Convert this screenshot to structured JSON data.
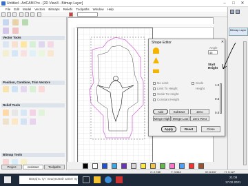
{
  "window": {
    "title": "Untitled - ArtCAM Pro - [2D View3 - Bitmap Layer]"
  },
  "menu": [
    "File",
    "Edit",
    "Model",
    "Vectors",
    "Bitmaps",
    "Reliefs",
    "Toolpaths",
    "Window",
    "Help"
  ],
  "left_panel": {
    "sections": {
      "vector_tools": "Vector Tools",
      "position": "Position, Combine, Trim Vectors",
      "relief_tools": "Relief Tools",
      "bitmap_tools": "Bitmap Tools"
    },
    "tabs": [
      "Project",
      "Assistant",
      "Toolpaths"
    ]
  },
  "right_panel": {
    "bitmap_label": "Bitmap Layer"
  },
  "dialog": {
    "title": "Shape Editor",
    "angle_label": "Angle",
    "angle_value": "45",
    "start_height_label": "Start Height",
    "no_limit": "No Limit",
    "limit_to_height": "Limit To Height",
    "scale_to_height": "Scale To Height",
    "constant_height": "Constant Height",
    "scale_label": "Scale",
    "height_label": "Height",
    "scale_right": "Scale",
    "top_value": "1.0",
    "mid_value": "0.5",
    "bottom_value": "0.0",
    "buttons": {
      "add": "Add",
      "subtract": "Subtract",
      "zero": "Zero",
      "merge_high": "Merge High",
      "merge_low": "Merge Low",
      "zero_rest": "Zero Rest",
      "apply": "Apply",
      "reset": "Reset",
      "close": "Close"
    }
  },
  "palette_colors": [
    "#000000",
    "#ffffff",
    "#1f4fd8",
    "#37a8e6",
    "#6c2fbf",
    "#d7d7d7",
    "#ffe93b",
    "#f4c542",
    "#63b947",
    "#ff6fcf",
    "#4aa0ff",
    "#ff2e2e",
    "#a0522d"
  ],
  "status": {
    "coords1": "X: 2.788",
    "coords2": "Y: 3.542",
    "coords3": "W: 6.537",
    "coords4": "H: 5.127"
  },
  "taskbar": {
    "search_placeholder": "Введіть тут пошуковий запит пу",
    "time": "21:08",
    "date": "17.02.2021"
  }
}
